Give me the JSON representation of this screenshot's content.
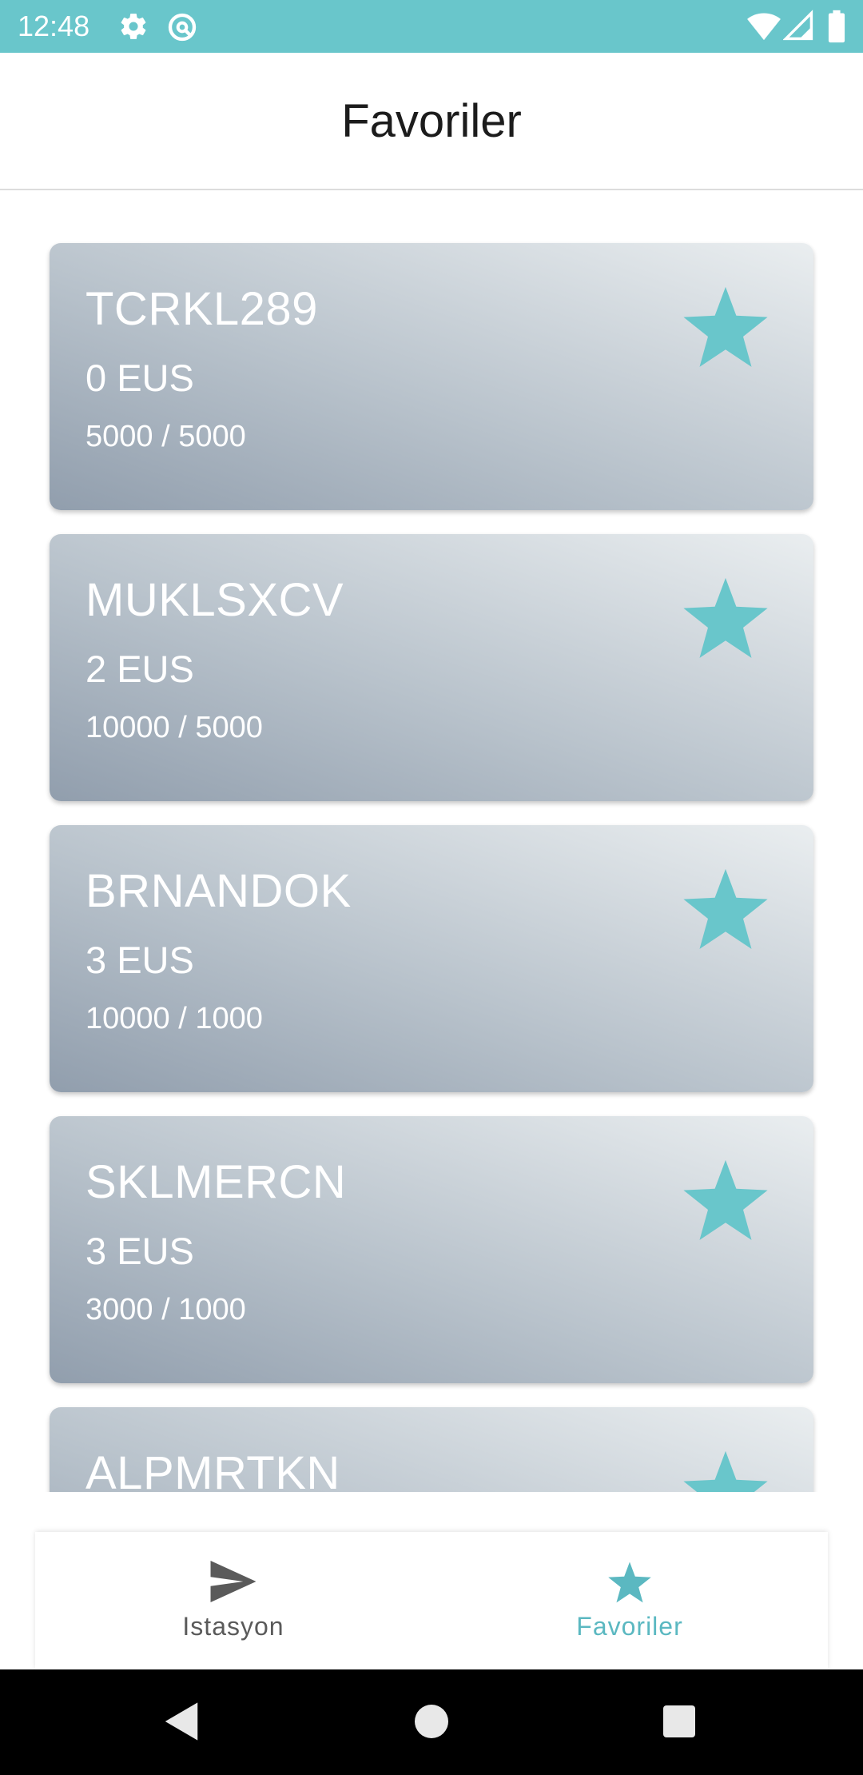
{
  "status_bar": {
    "time": "12:48",
    "icons": [
      "gear-icon",
      "sync-icon",
      "wifi-icon",
      "signal-icon",
      "battery-icon"
    ]
  },
  "header": {
    "title": "Favoriler"
  },
  "cards": [
    {
      "name": "TCRKL289",
      "price": "0 EUS",
      "capacity": "5000 / 5000"
    },
    {
      "name": "MUKLSXCV",
      "price": "2 EUS",
      "capacity": "10000 / 5000"
    },
    {
      "name": "BRNANDOK",
      "price": "3 EUS",
      "capacity": "10000 / 1000"
    },
    {
      "name": "SKLMERCN",
      "price": "3 EUS",
      "capacity": "3000 / 1000"
    },
    {
      "name": "ALPMRTKN",
      "price": "",
      "capacity": ""
    }
  ],
  "bottom_nav": {
    "items": [
      {
        "label": "Istasyon",
        "icon": "send-icon",
        "active": false
      },
      {
        "label": "Favoriler",
        "icon": "star-icon",
        "active": true
      }
    ]
  },
  "colors": {
    "accent": "#5bb8c1",
    "status_bar": "#69c6cb",
    "inactive": "#5a5a5a",
    "card_gradient_start": "#919ead",
    "card_gradient_end": "#eaeef0"
  }
}
